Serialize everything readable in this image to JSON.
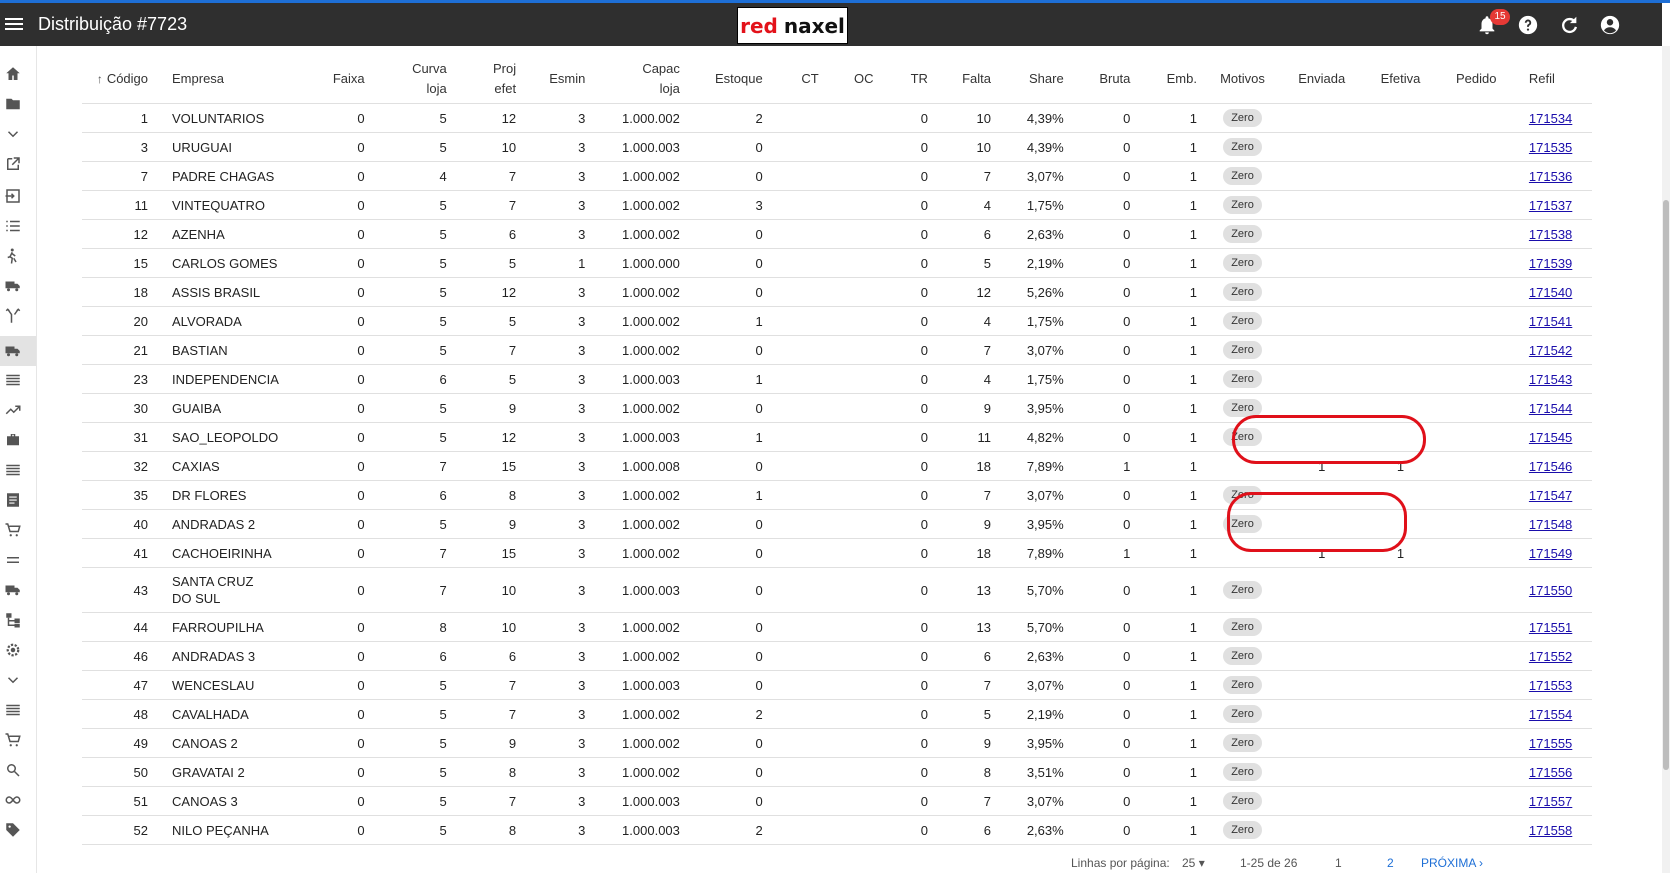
{
  "app": {
    "title": "Distribuição #7723",
    "logo_left": "red",
    "logo_right": "naxel",
    "notification_count": "15"
  },
  "colors": {
    "appbar": "#2f2f2f",
    "accent": "#1e6fd6",
    "highlight": "#e0101a"
  },
  "columns": {
    "codigo": "Código",
    "empresa": "Empresa",
    "faixa": "Faixa",
    "curva_1": "Curva",
    "curva_2": "loja",
    "proj_1": "Proj",
    "proj_2": "efet",
    "esmin": "Esmin",
    "capac_1": "Capac",
    "capac_2": "loja",
    "estoque": "Estoque",
    "ct": "CT",
    "oc": "OC",
    "tr": "TR",
    "falta": "Falta",
    "share": "Share",
    "bruta": "Bruta",
    "emb": "Emb.",
    "motivos": "Motivos",
    "enviada": "Enviada",
    "efetiva": "Efetiva",
    "pedido": "Pedido",
    "refil": "Refil"
  },
  "rows": [
    {
      "codigo": "1",
      "empresa": "VOLUNTARIOS",
      "faixa": "0",
      "curva": "5",
      "proj": "12",
      "esmin": "3",
      "capac": "1.000.002",
      "estoque": "2",
      "ct": "",
      "oc": "",
      "tr": "0",
      "falta": "10",
      "share": "4,39%",
      "bruta": "0",
      "emb": "1",
      "motivo": "Zero",
      "enviada": "",
      "efetiva": "",
      "pedido": "",
      "refil": "171534"
    },
    {
      "codigo": "3",
      "empresa": "URUGUAI",
      "faixa": "0",
      "curva": "5",
      "proj": "10",
      "esmin": "3",
      "capac": "1.000.003",
      "estoque": "0",
      "ct": "",
      "oc": "",
      "tr": "0",
      "falta": "10",
      "share": "4,39%",
      "bruta": "0",
      "emb": "1",
      "motivo": "Zero",
      "enviada": "",
      "efetiva": "",
      "pedido": "",
      "refil": "171535"
    },
    {
      "codigo": "7",
      "empresa": "PADRE CHAGAS",
      "faixa": "0",
      "curva": "4",
      "proj": "7",
      "esmin": "3",
      "capac": "1.000.002",
      "estoque": "0",
      "ct": "",
      "oc": "",
      "tr": "0",
      "falta": "7",
      "share": "3,07%",
      "bruta": "0",
      "emb": "1",
      "motivo": "Zero",
      "enviada": "",
      "efetiva": "",
      "pedido": "",
      "refil": "171536"
    },
    {
      "codigo": "11",
      "empresa": "VINTEQUATRO",
      "faixa": "0",
      "curva": "5",
      "proj": "7",
      "esmin": "3",
      "capac": "1.000.002",
      "estoque": "3",
      "ct": "",
      "oc": "",
      "tr": "0",
      "falta": "4",
      "share": "1,75%",
      "bruta": "0",
      "emb": "1",
      "motivo": "Zero",
      "enviada": "",
      "efetiva": "",
      "pedido": "",
      "refil": "171537"
    },
    {
      "codigo": "12",
      "empresa": "AZENHA",
      "faixa": "0",
      "curva": "5",
      "proj": "6",
      "esmin": "3",
      "capac": "1.000.002",
      "estoque": "0",
      "ct": "",
      "oc": "",
      "tr": "0",
      "falta": "6",
      "share": "2,63%",
      "bruta": "0",
      "emb": "1",
      "motivo": "Zero",
      "enviada": "",
      "efetiva": "",
      "pedido": "",
      "refil": "171538"
    },
    {
      "codigo": "15",
      "empresa": "CARLOS GOMES",
      "faixa": "0",
      "curva": "5",
      "proj": "5",
      "esmin": "1",
      "capac": "1.000.000",
      "estoque": "0",
      "ct": "",
      "oc": "",
      "tr": "0",
      "falta": "5",
      "share": "2,19%",
      "bruta": "0",
      "emb": "1",
      "motivo": "Zero",
      "enviada": "",
      "efetiva": "",
      "pedido": "",
      "refil": "171539"
    },
    {
      "codigo": "18",
      "empresa": "ASSIS BRASIL",
      "faixa": "0",
      "curva": "5",
      "proj": "12",
      "esmin": "3",
      "capac": "1.000.002",
      "estoque": "0",
      "ct": "",
      "oc": "",
      "tr": "0",
      "falta": "12",
      "share": "5,26%",
      "bruta": "0",
      "emb": "1",
      "motivo": "Zero",
      "enviada": "",
      "efetiva": "",
      "pedido": "",
      "refil": "171540"
    },
    {
      "codigo": "20",
      "empresa": "ALVORADA",
      "faixa": "0",
      "curva": "5",
      "proj": "5",
      "esmin": "3",
      "capac": "1.000.002",
      "estoque": "1",
      "ct": "",
      "oc": "",
      "tr": "0",
      "falta": "4",
      "share": "1,75%",
      "bruta": "0",
      "emb": "1",
      "motivo": "Zero",
      "enviada": "",
      "efetiva": "",
      "pedido": "",
      "refil": "171541"
    },
    {
      "codigo": "21",
      "empresa": "BASTIAN",
      "faixa": "0",
      "curva": "5",
      "proj": "7",
      "esmin": "3",
      "capac": "1.000.002",
      "estoque": "0",
      "ct": "",
      "oc": "",
      "tr": "0",
      "falta": "7",
      "share": "3,07%",
      "bruta": "0",
      "emb": "1",
      "motivo": "Zero",
      "enviada": "",
      "efetiva": "",
      "pedido": "",
      "refil": "171542"
    },
    {
      "codigo": "23",
      "empresa": "INDEPENDENCIA",
      "faixa": "0",
      "curva": "6",
      "proj": "5",
      "esmin": "3",
      "capac": "1.000.003",
      "estoque": "1",
      "ct": "",
      "oc": "",
      "tr": "0",
      "falta": "4",
      "share": "1,75%",
      "bruta": "0",
      "emb": "1",
      "motivo": "Zero",
      "enviada": "",
      "efetiva": "",
      "pedido": "",
      "refil": "171543"
    },
    {
      "codigo": "30",
      "empresa": "GUAIBA",
      "faixa": "0",
      "curva": "5",
      "proj": "9",
      "esmin": "3",
      "capac": "1.000.002",
      "estoque": "0",
      "ct": "",
      "oc": "",
      "tr": "0",
      "falta": "9",
      "share": "3,95%",
      "bruta": "0",
      "emb": "1",
      "motivo": "Zero",
      "enviada": "",
      "efetiva": "",
      "pedido": "",
      "refil": "171544"
    },
    {
      "codigo": "31",
      "empresa": "SAO_LEOPOLDO",
      "faixa": "0",
      "curva": "5",
      "proj": "12",
      "esmin": "3",
      "capac": "1.000.003",
      "estoque": "1",
      "ct": "",
      "oc": "",
      "tr": "0",
      "falta": "11",
      "share": "4,82%",
      "bruta": "0",
      "emb": "1",
      "motivo": "Zero",
      "enviada": "",
      "efetiva": "",
      "pedido": "",
      "refil": "171545"
    },
    {
      "codigo": "32",
      "empresa": "CAXIAS",
      "faixa": "0",
      "curva": "7",
      "proj": "15",
      "esmin": "3",
      "capac": "1.000.008",
      "estoque": "0",
      "ct": "",
      "oc": "",
      "tr": "0",
      "falta": "18",
      "share": "7,89%",
      "bruta": "1",
      "emb": "1",
      "motivo": "",
      "enviada": "1",
      "efetiva": "1",
      "pedido": "",
      "refil": "171546"
    },
    {
      "codigo": "35",
      "empresa": "DR FLORES",
      "faixa": "0",
      "curva": "6",
      "proj": "8",
      "esmin": "3",
      "capac": "1.000.002",
      "estoque": "1",
      "ct": "",
      "oc": "",
      "tr": "0",
      "falta": "7",
      "share": "3,07%",
      "bruta": "0",
      "emb": "1",
      "motivo": "Zero",
      "enviada": "",
      "efetiva": "",
      "pedido": "",
      "refil": "171547"
    },
    {
      "codigo": "40",
      "empresa": "ANDRADAS 2",
      "faixa": "0",
      "curva": "5",
      "proj": "9",
      "esmin": "3",
      "capac": "1.000.002",
      "estoque": "0",
      "ct": "",
      "oc": "",
      "tr": "0",
      "falta": "9",
      "share": "3,95%",
      "bruta": "0",
      "emb": "1",
      "motivo": "Zero",
      "enviada": "",
      "efetiva": "",
      "pedido": "",
      "refil": "171548"
    },
    {
      "codigo": "41",
      "empresa": "CACHOEIRINHA",
      "faixa": "0",
      "curva": "7",
      "proj": "15",
      "esmin": "3",
      "capac": "1.000.002",
      "estoque": "0",
      "ct": "",
      "oc": "",
      "tr": "0",
      "falta": "18",
      "share": "7,89%",
      "bruta": "1",
      "emb": "1",
      "motivo": "",
      "enviada": "1",
      "efetiva": "1",
      "pedido": "",
      "refil": "171549"
    },
    {
      "codigo": "43",
      "empresa": "SANTA CRUZ DO SUL",
      "faixa": "0",
      "curva": "7",
      "proj": "10",
      "esmin": "3",
      "capac": "1.000.003",
      "estoque": "0",
      "ct": "",
      "oc": "",
      "tr": "0",
      "falta": "13",
      "share": "5,70%",
      "bruta": "0",
      "emb": "1",
      "motivo": "Zero",
      "enviada": "",
      "efetiva": "",
      "pedido": "",
      "refil": "171550"
    },
    {
      "codigo": "44",
      "empresa": "FARROUPILHA",
      "faixa": "0",
      "curva": "8",
      "proj": "10",
      "esmin": "3",
      "capac": "1.000.002",
      "estoque": "0",
      "ct": "",
      "oc": "",
      "tr": "0",
      "falta": "13",
      "share": "5,70%",
      "bruta": "0",
      "emb": "1",
      "motivo": "Zero",
      "enviada": "",
      "efetiva": "",
      "pedido": "",
      "refil": "171551"
    },
    {
      "codigo": "46",
      "empresa": "ANDRADAS 3",
      "faixa": "0",
      "curva": "6",
      "proj": "6",
      "esmin": "3",
      "capac": "1.000.002",
      "estoque": "0",
      "ct": "",
      "oc": "",
      "tr": "0",
      "falta": "6",
      "share": "2,63%",
      "bruta": "0",
      "emb": "1",
      "motivo": "Zero",
      "enviada": "",
      "efetiva": "",
      "pedido": "",
      "refil": "171552"
    },
    {
      "codigo": "47",
      "empresa": "WENCESLAU",
      "faixa": "0",
      "curva": "5",
      "proj": "7",
      "esmin": "3",
      "capac": "1.000.003",
      "estoque": "0",
      "ct": "",
      "oc": "",
      "tr": "0",
      "falta": "7",
      "share": "3,07%",
      "bruta": "0",
      "emb": "1",
      "motivo": "Zero",
      "enviada": "",
      "efetiva": "",
      "pedido": "",
      "refil": "171553"
    },
    {
      "codigo": "48",
      "empresa": "CAVALHADA",
      "faixa": "0",
      "curva": "5",
      "proj": "7",
      "esmin": "3",
      "capac": "1.000.002",
      "estoque": "2",
      "ct": "",
      "oc": "",
      "tr": "0",
      "falta": "5",
      "share": "2,19%",
      "bruta": "0",
      "emb": "1",
      "motivo": "Zero",
      "enviada": "",
      "efetiva": "",
      "pedido": "",
      "refil": "171554"
    },
    {
      "codigo": "49",
      "empresa": "CANOAS 2",
      "faixa": "0",
      "curva": "5",
      "proj": "9",
      "esmin": "3",
      "capac": "1.000.002",
      "estoque": "0",
      "ct": "",
      "oc": "",
      "tr": "0",
      "falta": "9",
      "share": "3,95%",
      "bruta": "0",
      "emb": "1",
      "motivo": "Zero",
      "enviada": "",
      "efetiva": "",
      "pedido": "",
      "refil": "171555"
    },
    {
      "codigo": "50",
      "empresa": "GRAVATAI 2",
      "faixa": "0",
      "curva": "5",
      "proj": "8",
      "esmin": "3",
      "capac": "1.000.002",
      "estoque": "0",
      "ct": "",
      "oc": "",
      "tr": "0",
      "falta": "8",
      "share": "3,51%",
      "bruta": "0",
      "emb": "1",
      "motivo": "Zero",
      "enviada": "",
      "efetiva": "",
      "pedido": "",
      "refil": "171556"
    },
    {
      "codigo": "51",
      "empresa": "CANOAS 3",
      "faixa": "0",
      "curva": "5",
      "proj": "7",
      "esmin": "3",
      "capac": "1.000.003",
      "estoque": "0",
      "ct": "",
      "oc": "",
      "tr": "0",
      "falta": "7",
      "share": "3,07%",
      "bruta": "0",
      "emb": "1",
      "motivo": "Zero",
      "enviada": "",
      "efetiva": "",
      "pedido": "",
      "refil": "171557"
    },
    {
      "codigo": "52",
      "empresa": "NILO PEÇANHA",
      "faixa": "0",
      "curva": "5",
      "proj": "8",
      "esmin": "3",
      "capac": "1.000.003",
      "estoque": "2",
      "ct": "",
      "oc": "",
      "tr": "0",
      "falta": "6",
      "share": "2,63%",
      "bruta": "0",
      "emb": "1",
      "motivo": "Zero",
      "enviada": "",
      "efetiva": "",
      "pedido": "",
      "refil": "171558"
    }
  ],
  "footer": {
    "rows_label": "Linhas por página:",
    "rows_value": "25",
    "range": "1-25 de 26",
    "page_1": "1",
    "page_2": "2",
    "next": "PRÓXIMA"
  }
}
